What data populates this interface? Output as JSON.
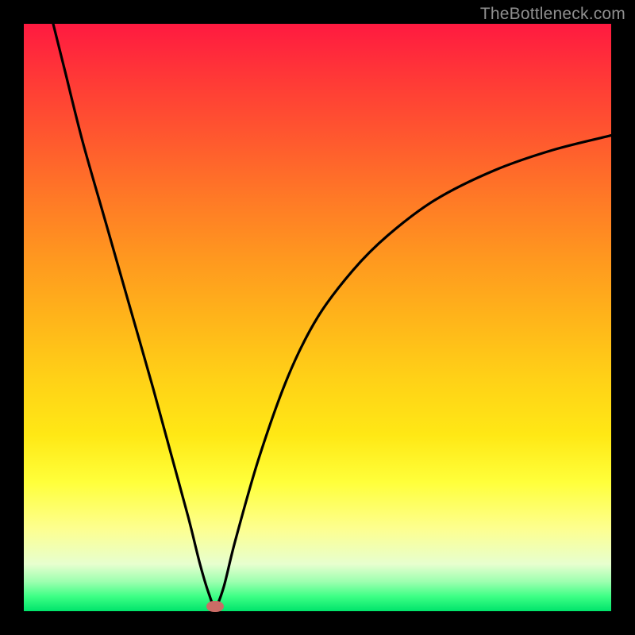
{
  "watermark": "TheBottleneck.com",
  "chart_data": {
    "type": "line",
    "title": "",
    "xlabel": "",
    "ylabel": "",
    "xlim": [
      0,
      100
    ],
    "ylim": [
      0,
      100
    ],
    "grid": false,
    "legend": false,
    "background_gradient": {
      "top_color": "#ff1a40",
      "bottom_color": "#00e46b",
      "description": "red (high bottleneck) at top to green (balanced) at bottom"
    },
    "series": [
      {
        "name": "bottleneck-curve",
        "color": "#000000",
        "x": [
          5,
          7,
          10,
          14,
          18,
          22,
          25,
          28,
          30,
          31.5,
          32.6,
          34,
          36,
          40,
          45,
          50,
          56,
          62,
          70,
          80,
          90,
          100
        ],
        "values": [
          100,
          92,
          80,
          66,
          52,
          38,
          27,
          16,
          8,
          3,
          0.8,
          4,
          12,
          26,
          40,
          50,
          58,
          64,
          70,
          75,
          78.5,
          81
        ]
      }
    ],
    "marker": {
      "x": 32.6,
      "y": 0.8,
      "color": "#cb6c66",
      "shape": "pill"
    }
  }
}
